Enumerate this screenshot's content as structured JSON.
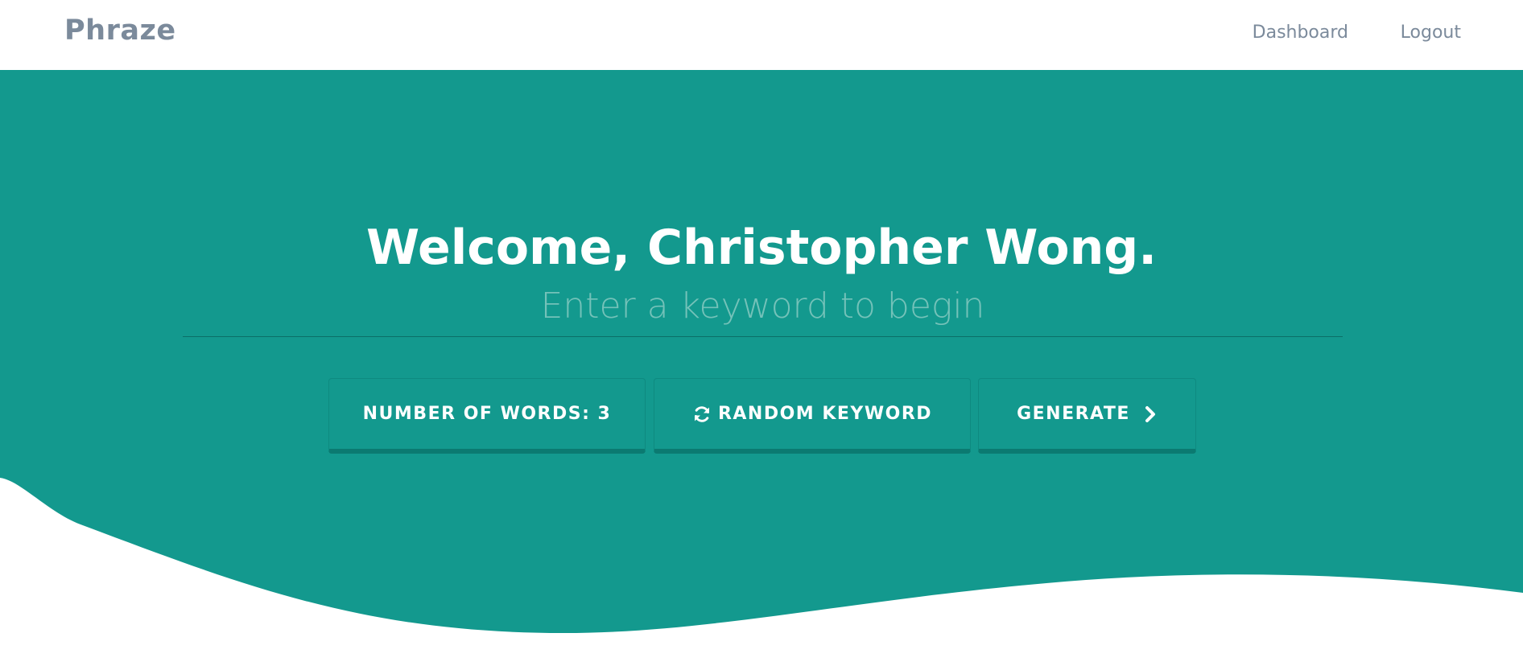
{
  "navbar": {
    "brand": "Phraze",
    "links": [
      {
        "label": "Dashboard"
      },
      {
        "label": "Logout"
      }
    ]
  },
  "hero": {
    "welcome": "Welcome, Christopher Wong.",
    "keyword_input": {
      "placeholder": "Enter a keyword to begin",
      "value": ""
    },
    "buttons": {
      "number_of_words": "NUMBER OF WORDS: 3",
      "random_keyword": "RANDOM KEYWORD",
      "generate": "GENERATE"
    }
  },
  "icons": {
    "random_keyword": "refresh-icon",
    "generate": "chevron-right-icon"
  },
  "colors": {
    "accent": "#13998e",
    "nav_text": "#7b8a9b",
    "background": "#ffffff",
    "placeholder": "#74c2b9"
  }
}
